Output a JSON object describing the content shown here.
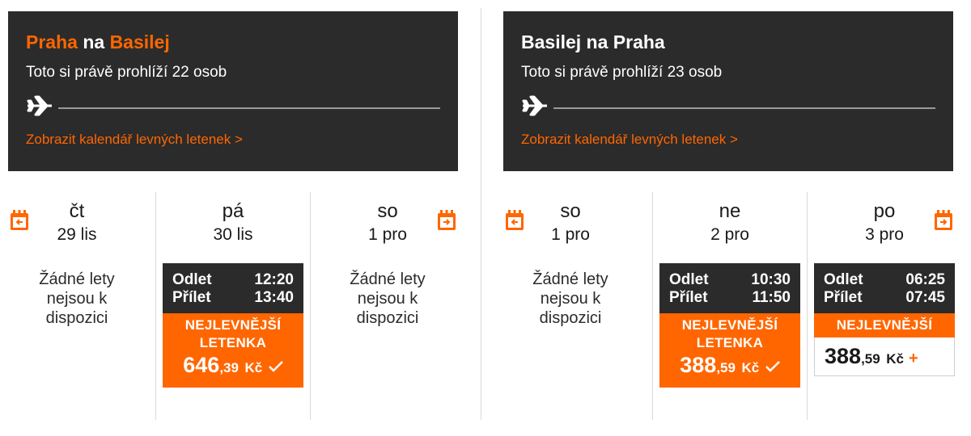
{
  "outbound": {
    "origin": "Praha",
    "connector": "na",
    "destination": "Basilej",
    "viewers": "Toto si právě prohlíží 22 osob",
    "calendar_link": "Zobrazit kalendář levných letenek >",
    "days": [
      {
        "name": "čt",
        "date": "29 lis",
        "no_flights": "Žádné lety nejsou k dispozici"
      },
      {
        "name": "pá",
        "date": "30 lis",
        "dep_label": "Odlet",
        "dep_time": "12:20",
        "arr_label": "Přílet",
        "arr_time": "13:40",
        "badge_1": "NEJLEVNĚJŠÍ",
        "badge_2": "LETENKA",
        "price_int": "646",
        "price_dec": ",39",
        "currency": "Kč"
      },
      {
        "name": "so",
        "date": "1 pro",
        "no_flights": "Žádné lety nejsou k dispozici"
      }
    ]
  },
  "return": {
    "origin": "Basilej",
    "connector": "na",
    "destination": "Praha",
    "viewers": "Toto si právě prohlíží 23 osob",
    "calendar_link": "Zobrazit kalendář levných letenek >",
    "days": [
      {
        "name": "so",
        "date": "1 pro",
        "no_flights": "Žádné lety nejsou k dispozici"
      },
      {
        "name": "ne",
        "date": "2 pro",
        "dep_label": "Odlet",
        "dep_time": "10:30",
        "arr_label": "Přílet",
        "arr_time": "11:50",
        "badge_1": "NEJLEVNĚJŠÍ",
        "badge_2": "LETENKA",
        "price_int": "388",
        "price_dec": ",59",
        "currency": "Kč"
      },
      {
        "name": "po",
        "date": "3 pro",
        "dep_label": "Odlet",
        "dep_time": "06:25",
        "arr_label": "Přílet",
        "arr_time": "07:45",
        "badge_1": "NEJLEVNĚJŠÍ",
        "price_int": "388",
        "price_dec": ",59",
        "currency": "Kč",
        "add_symbol": "+"
      }
    ]
  },
  "colors": {
    "accent": "#ff6600",
    "header_bg": "#2b2b2b"
  },
  "icons": {
    "plane": "plane-icon",
    "calendar_prev": "calendar-prev-icon",
    "calendar_next": "calendar-next-icon",
    "check": "check-icon"
  }
}
